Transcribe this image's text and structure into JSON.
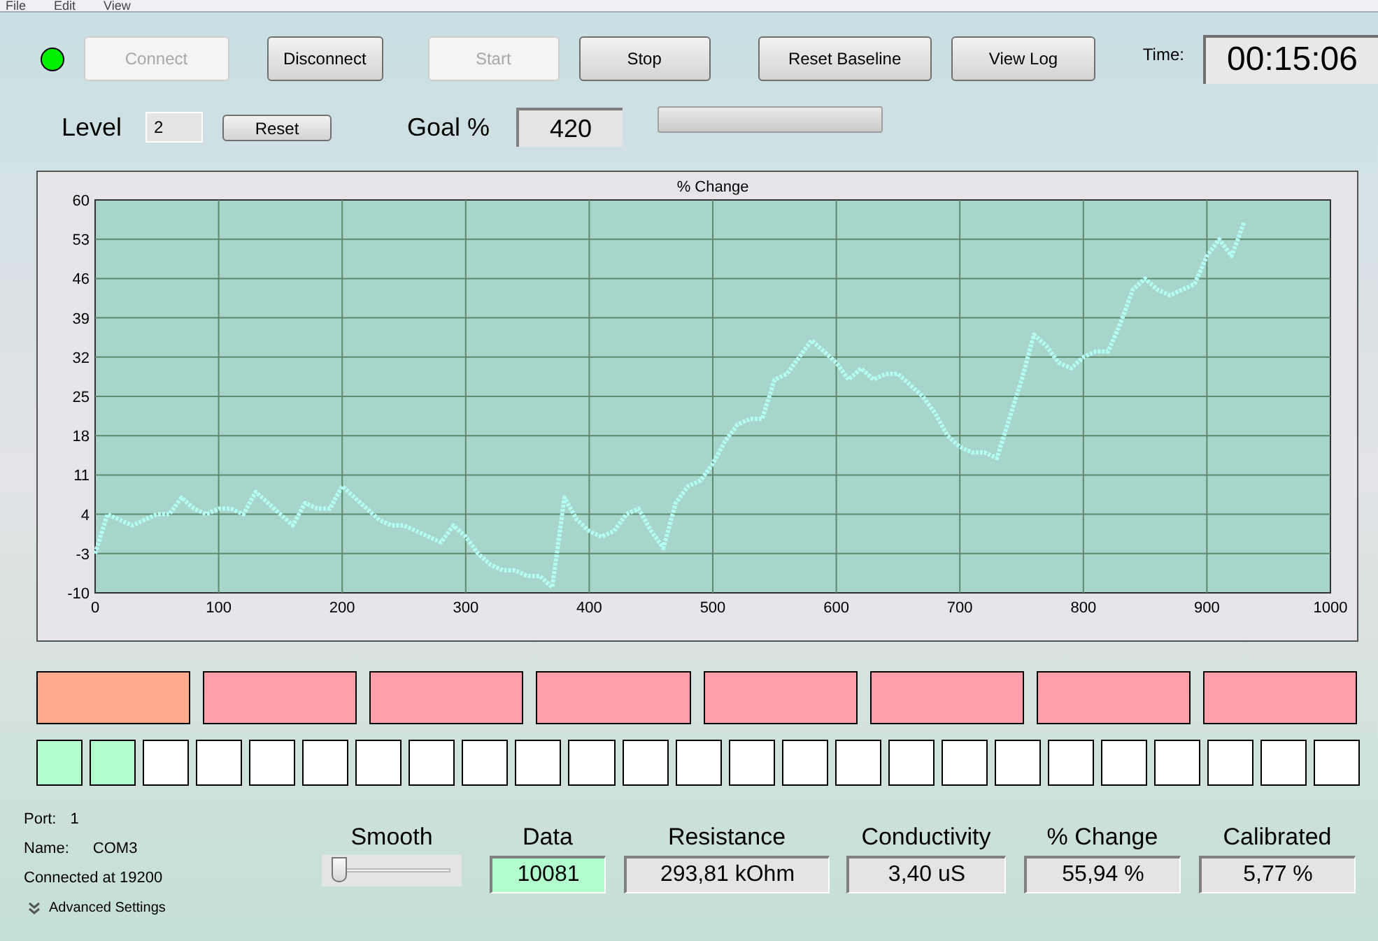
{
  "menu": [
    "File",
    "Edit",
    "View"
  ],
  "connected": true,
  "top_buttons": [
    {
      "label": "Connect",
      "disabled": true
    },
    {
      "label": "Disconnect",
      "disabled": false
    },
    {
      "label": "Start",
      "disabled": true
    },
    {
      "label": "Stop",
      "disabled": false
    },
    {
      "label": "Reset Baseline",
      "disabled": false
    },
    {
      "label": "View Log",
      "disabled": false
    }
  ],
  "time": {
    "label": "Time:",
    "value": "00:15:06"
  },
  "level": {
    "label": "Level",
    "value": "2",
    "button": "Reset"
  },
  "goal": {
    "label": "Goal %",
    "value": "420"
  },
  "progress": {
    "level": 0
  },
  "chart_data": {
    "type": "line",
    "title": "% Change",
    "xlim": [
      0,
      1000
    ],
    "ylim": [
      -10,
      60
    ],
    "xticks": [
      0,
      100,
      200,
      300,
      400,
      500,
      600,
      700,
      800,
      900,
      1000
    ],
    "yticks": [
      -10,
      -3,
      4,
      11,
      18,
      25,
      32,
      39,
      46,
      53,
      60
    ],
    "x": [
      0,
      10,
      20,
      30,
      40,
      50,
      60,
      70,
      80,
      90,
      100,
      110,
      120,
      130,
      140,
      150,
      160,
      170,
      180,
      190,
      200,
      210,
      220,
      230,
      240,
      250,
      260,
      270,
      280,
      290,
      300,
      310,
      320,
      330,
      340,
      350,
      360,
      370,
      380,
      390,
      400,
      410,
      420,
      430,
      440,
      450,
      460,
      470,
      480,
      490,
      500,
      510,
      520,
      530,
      540,
      550,
      560,
      570,
      580,
      590,
      600,
      610,
      620,
      630,
      640,
      650,
      660,
      670,
      680,
      690,
      700,
      710,
      720,
      730,
      740,
      750,
      760,
      770,
      780,
      790,
      800,
      810,
      820,
      830,
      840,
      850,
      860,
      870,
      880,
      890,
      900,
      910,
      920,
      930
    ],
    "grid": true,
    "series": [
      {
        "color": "#b4fff4",
        "line_style": "dotted",
        "values": [
          -3,
          4,
          3,
          2,
          3,
          4,
          4,
          7,
          5,
          4,
          5,
          5,
          4,
          8,
          6,
          4,
          2,
          6,
          5,
          5,
          9,
          7,
          5,
          3,
          2,
          2,
          1,
          0,
          -1,
          2,
          0,
          -3,
          -5,
          -6,
          -6,
          -7,
          -7,
          -9,
          7,
          3,
          1,
          0,
          1,
          4,
          5,
          1,
          -2,
          6,
          9,
          10,
          13,
          17,
          20,
          21,
          21,
          28,
          29,
          32,
          35,
          33,
          31,
          28,
          30,
          28,
          29,
          29,
          27,
          25,
          22,
          18,
          16,
          15,
          15,
          14,
          21,
          28,
          36,
          34,
          31,
          30,
          32,
          33,
          33,
          38,
          44,
          46,
          44,
          43,
          44,
          45,
          50,
          53,
          50,
          56
        ]
      }
    ]
  },
  "zones": [
    {
      "color": "#ffaa8c"
    },
    {
      "color": "#ff9faa"
    },
    {
      "color": "#ff9faa"
    },
    {
      "color": "#ff9faa"
    },
    {
      "color": "#ff9faa"
    },
    {
      "color": "#ff9faa"
    },
    {
      "color": "#ff9faa"
    },
    {
      "color": "#ff9faa"
    }
  ],
  "steps": [
    {
      "on": true
    },
    {
      "on": true
    },
    {
      "on": false
    },
    {
      "on": false
    },
    {
      "on": false
    },
    {
      "on": false
    },
    {
      "on": false
    },
    {
      "on": false
    },
    {
      "on": false
    },
    {
      "on": false
    },
    {
      "on": false
    },
    {
      "on": false
    },
    {
      "on": false
    },
    {
      "on": false
    },
    {
      "on": false
    },
    {
      "on": false
    },
    {
      "on": false
    },
    {
      "on": false
    },
    {
      "on": false
    },
    {
      "on": false
    },
    {
      "on": false
    },
    {
      "on": false
    },
    {
      "on": false
    },
    {
      "on": false
    },
    {
      "on": false
    }
  ],
  "port": {
    "port_label": "Port:",
    "port": "1",
    "name_label": "Name:",
    "name": "COM3",
    "status": "Connected at 19200",
    "advanced": "Advanced Settings"
  },
  "smooth": {
    "label": "Smooth",
    "level": 0.05
  },
  "readouts": [
    {
      "label": "Data",
      "value": "10081",
      "highlighted": true
    },
    {
      "label": "Resistance",
      "value": "293,81 kOhm",
      "highlighted": false
    },
    {
      "label": "Conductivity",
      "value": "3,40 uS",
      "highlighted": false
    },
    {
      "label": "% Change",
      "value": "55,94 %",
      "highlighted": false
    },
    {
      "label": "Calibrated",
      "value": "5,77 %",
      "highlighted": false
    }
  ]
}
